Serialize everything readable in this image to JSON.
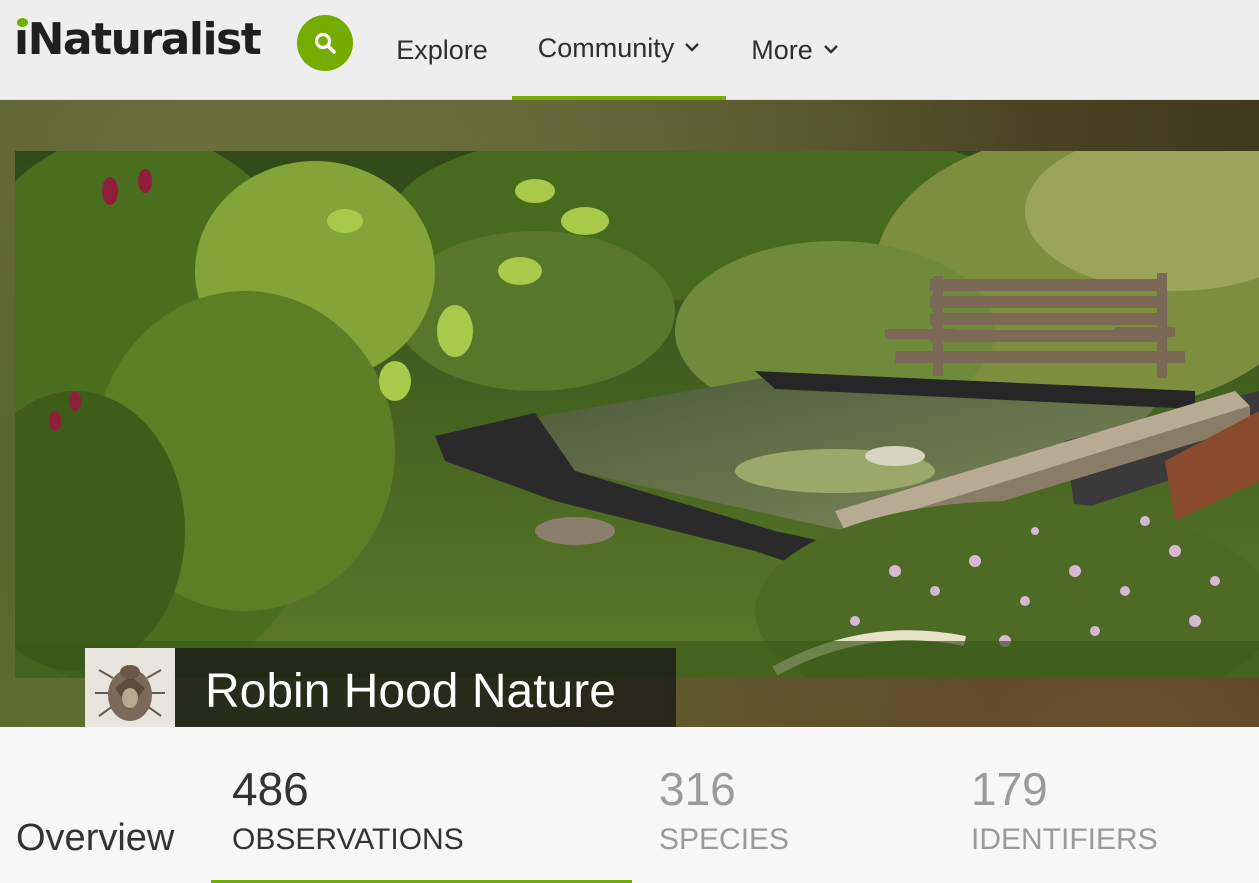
{
  "nav": {
    "logo_text": "iNaturalist",
    "explore_label": "Explore",
    "community_label": "Community",
    "more_label": "More",
    "accent_color": "#74ac00"
  },
  "project": {
    "title": "Robin Hood Nature",
    "icon": "stink-bug-photo",
    "cover": "garden-pond-with-bench-photo"
  },
  "stats": {
    "overview_label": "Overview",
    "observations": {
      "count": "486",
      "label": "OBSERVATIONS"
    },
    "species": {
      "count": "316",
      "label": "SPECIES"
    },
    "identifiers": {
      "count": "179",
      "label": "IDENTIFIERS"
    }
  }
}
